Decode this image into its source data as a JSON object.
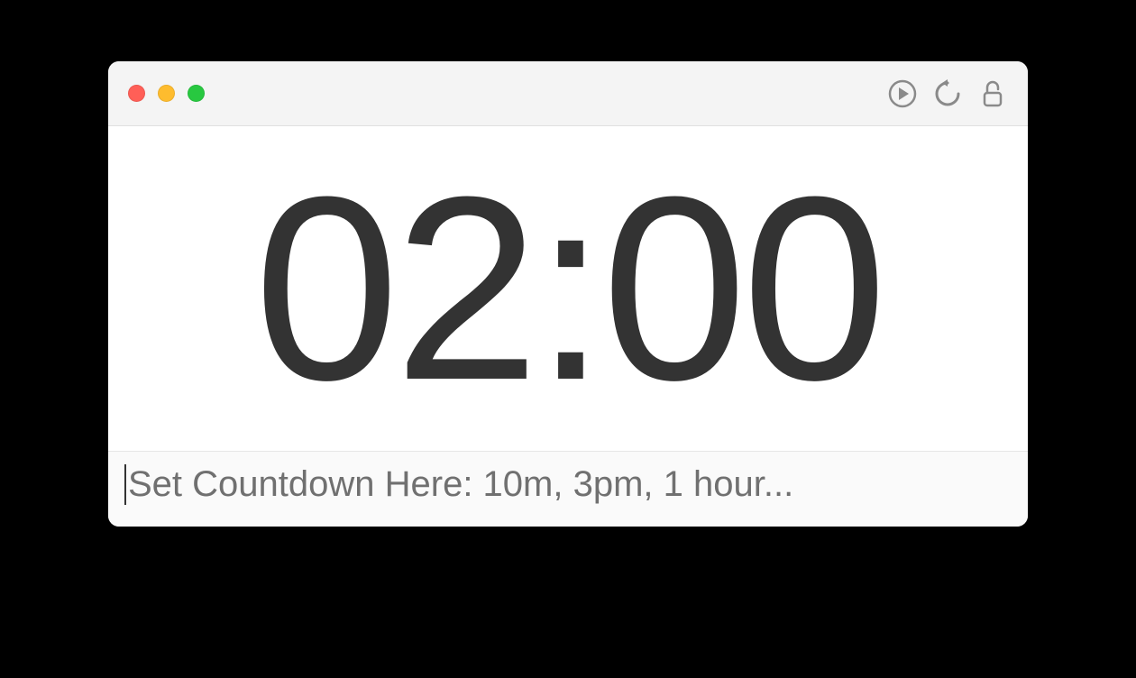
{
  "timer": {
    "display": "02:00"
  },
  "input": {
    "value": "",
    "placeholder": "Set Countdown Here: 10m, 3pm, 1 hour..."
  }
}
